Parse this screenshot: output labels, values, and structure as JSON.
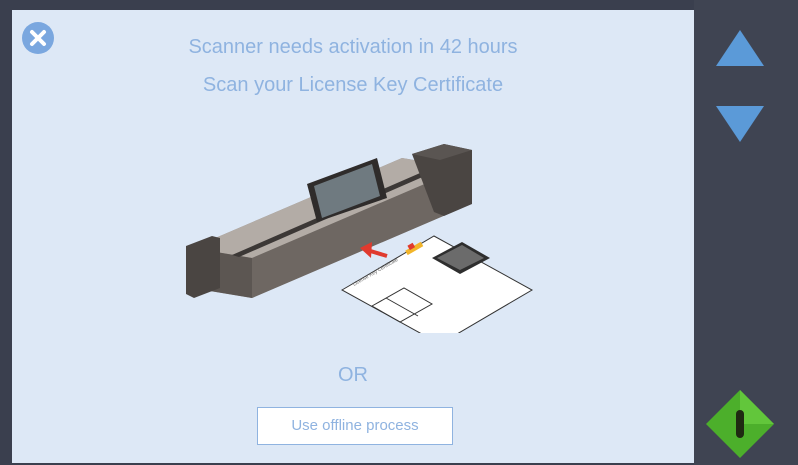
{
  "header": {
    "line1": "Scanner needs activation in 42 hours",
    "line2": "Scan your License Key Certificate"
  },
  "main": {
    "or_text": "OR",
    "offline_button_label": "Use offline process",
    "certificate": {
      "title_text": "License Key Certificate"
    }
  },
  "icons": {
    "close": "close-icon",
    "up": "arrow-up-icon",
    "down": "arrow-down-icon",
    "power": "power-icon"
  },
  "colors": {
    "background": "#dde8f6",
    "accent_text": "#8fb3e0",
    "sidebar": "#3f4452",
    "arrow": "#5b9ad8",
    "power_button": "#4caf2b"
  }
}
